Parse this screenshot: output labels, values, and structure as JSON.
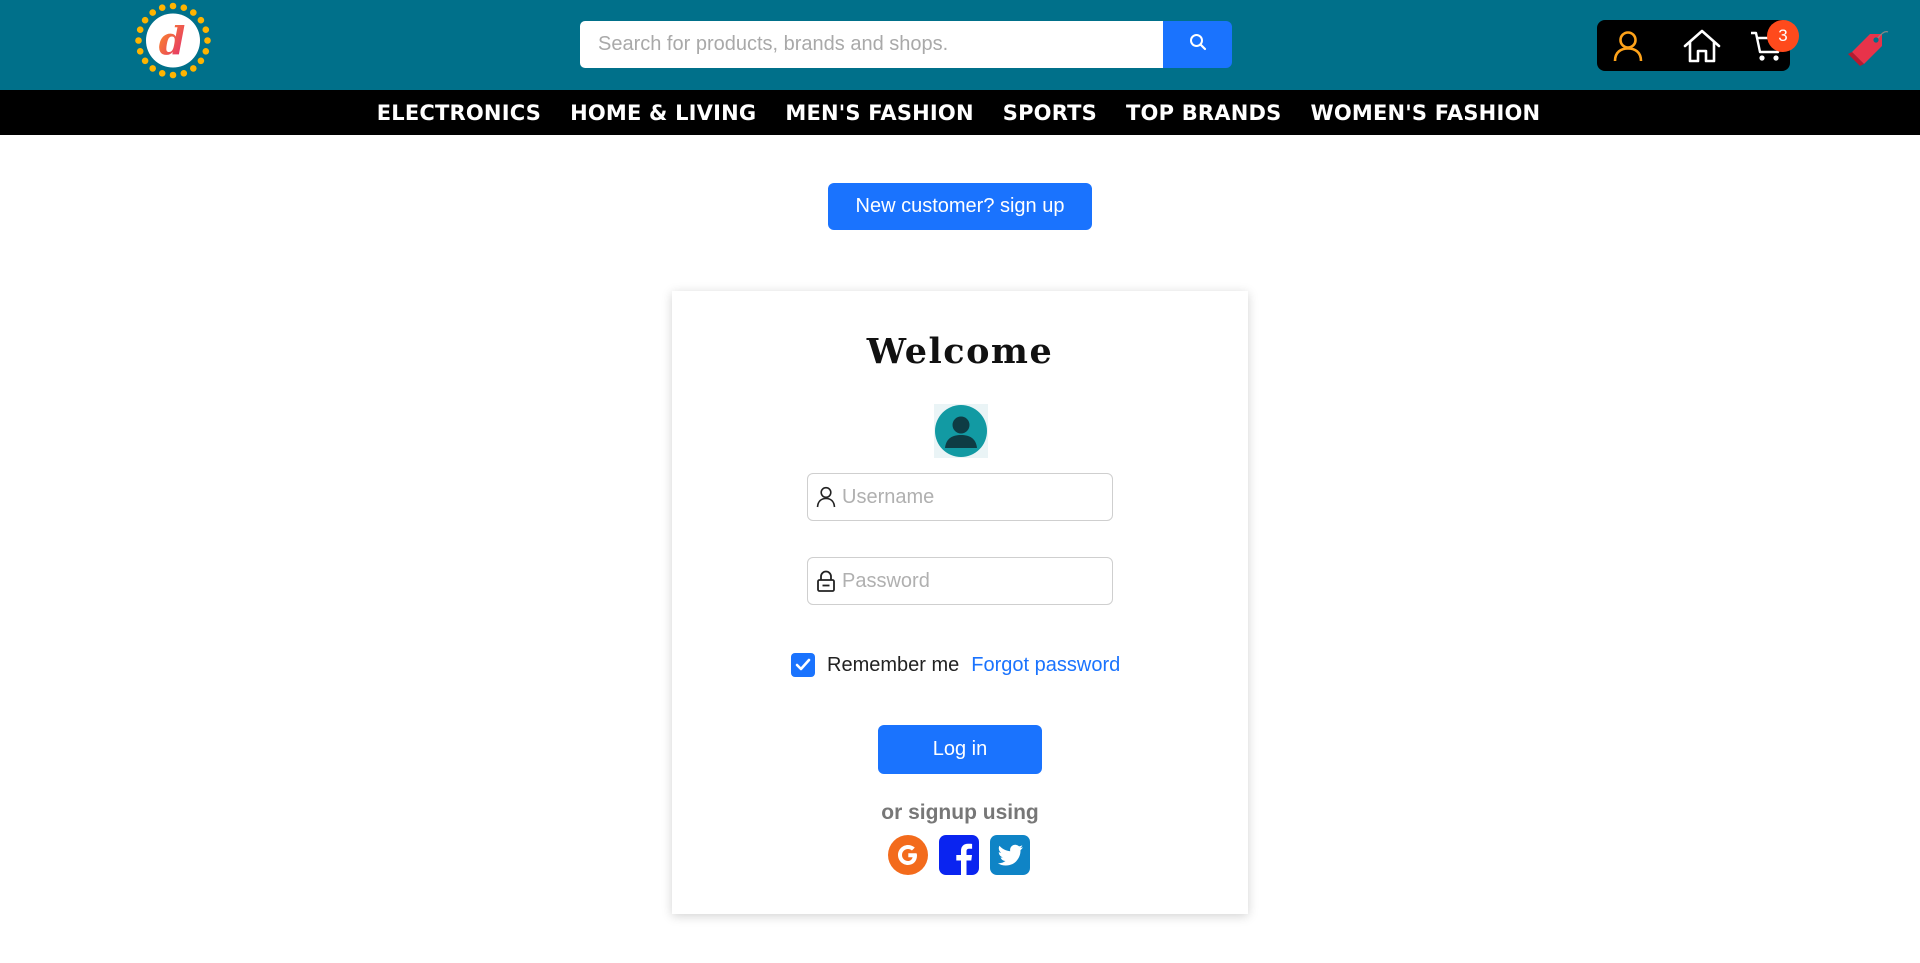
{
  "header": {
    "logo_letter": "d",
    "search": {
      "placeholder": "Search for products, brands and shops."
    },
    "icons": {
      "account": "user-icon",
      "home": "home-icon",
      "cart": "cart-icon",
      "tag": "tag-icon"
    },
    "cart_count": "3"
  },
  "nav": {
    "categories": [
      "ELECTRONICS",
      "HOME & LIVING",
      "MEN'S FASHION",
      "SPORTS",
      "TOP BRANDS",
      "WOMEN'S FASHION"
    ]
  },
  "signup_button": "New customer? sign up",
  "login": {
    "title": "Welcome",
    "username_placeholder": "Username",
    "password_placeholder": "Password",
    "remember_label": "Remember me",
    "remember_checked": true,
    "forgot_link": "Forgot password",
    "login_button": "Log in",
    "social_text": "or signup using",
    "social": [
      "google",
      "facebook",
      "twitter"
    ]
  },
  "colors": {
    "header_bg": "#00708a",
    "nav_bg": "#000000",
    "accent": "#1a73fe",
    "badge": "#ff4a1c",
    "logo_ring": "#ffb400"
  }
}
